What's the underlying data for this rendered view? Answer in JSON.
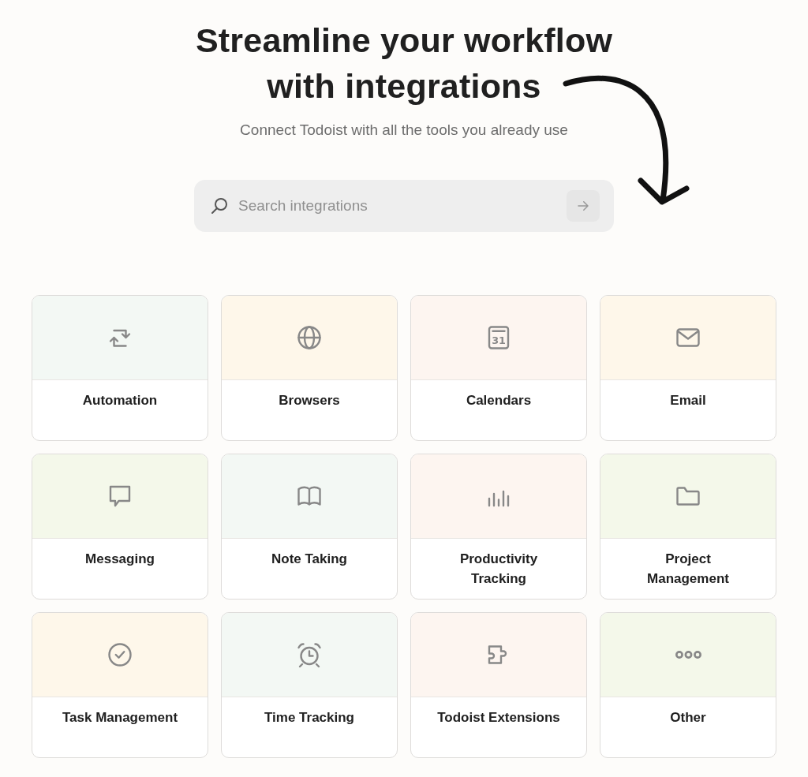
{
  "heading": {
    "title": "Streamline your workflow with integrations",
    "subtitle": "Connect Todoist with all the tools you already use"
  },
  "search": {
    "placeholder": "Search integrations"
  },
  "categories": [
    {
      "label": "Automation",
      "kind": "arrows",
      "color": "#f3f8f4"
    },
    {
      "label": "Browsers",
      "kind": "globe",
      "color": "#fef7ea"
    },
    {
      "label": "Calendars",
      "kind": "calendar",
      "icon_text": "31",
      "color": "#fdf5f0"
    },
    {
      "label": "Email",
      "kind": "envelope",
      "color": "#fef7ea"
    },
    {
      "label": "Messaging",
      "kind": "bubble",
      "color": "#f4f8ea"
    },
    {
      "label": "Note Taking",
      "kind": "book",
      "color": "#f3f8f4"
    },
    {
      "label": "Productivity Tracking",
      "kind": "bars",
      "color": "#fdf5f0"
    },
    {
      "label": "Project Management",
      "kind": "folder",
      "color": "#f4f8ea"
    },
    {
      "label": "Task Management",
      "kind": "check",
      "color": "#fef7ea"
    },
    {
      "label": "Time Tracking",
      "kind": "alarm",
      "color": "#f3f8f4"
    },
    {
      "label": "Todoist Extensions",
      "kind": "puzzle",
      "color": "#fdf5f0"
    },
    {
      "label": "Other",
      "kind": "dots",
      "color": "#f4f8ea"
    }
  ]
}
